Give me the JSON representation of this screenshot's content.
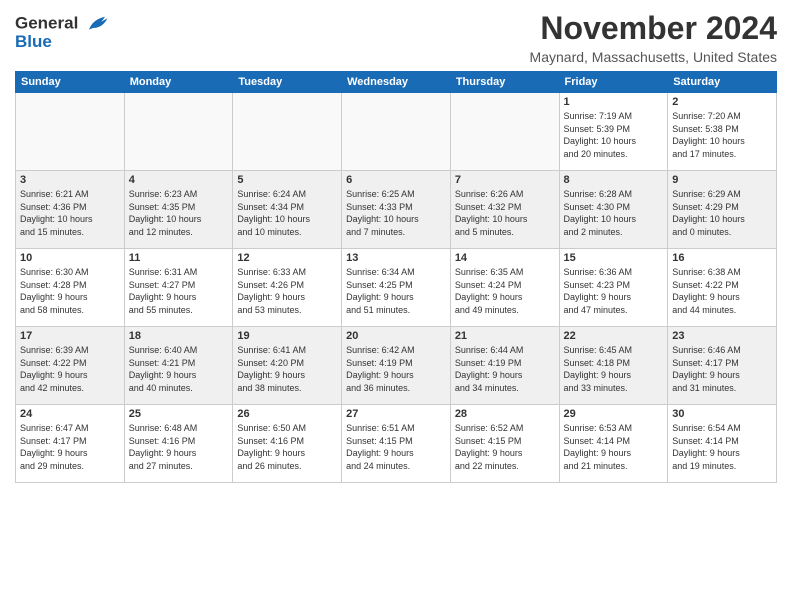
{
  "logo": {
    "line1": "General",
    "line2": "Blue"
  },
  "title": "November 2024",
  "location": "Maynard, Massachusetts, United States",
  "headers": [
    "Sunday",
    "Monday",
    "Tuesday",
    "Wednesday",
    "Thursday",
    "Friday",
    "Saturday"
  ],
  "rows": [
    [
      {
        "day": "",
        "info": ""
      },
      {
        "day": "",
        "info": ""
      },
      {
        "day": "",
        "info": ""
      },
      {
        "day": "",
        "info": ""
      },
      {
        "day": "",
        "info": ""
      },
      {
        "day": "1",
        "info": "Sunrise: 7:19 AM\nSunset: 5:39 PM\nDaylight: 10 hours\nand 20 minutes."
      },
      {
        "day": "2",
        "info": "Sunrise: 7:20 AM\nSunset: 5:38 PM\nDaylight: 10 hours\nand 17 minutes."
      }
    ],
    [
      {
        "day": "3",
        "info": "Sunrise: 6:21 AM\nSunset: 4:36 PM\nDaylight: 10 hours\nand 15 minutes."
      },
      {
        "day": "4",
        "info": "Sunrise: 6:23 AM\nSunset: 4:35 PM\nDaylight: 10 hours\nand 12 minutes."
      },
      {
        "day": "5",
        "info": "Sunrise: 6:24 AM\nSunset: 4:34 PM\nDaylight: 10 hours\nand 10 minutes."
      },
      {
        "day": "6",
        "info": "Sunrise: 6:25 AM\nSunset: 4:33 PM\nDaylight: 10 hours\nand 7 minutes."
      },
      {
        "day": "7",
        "info": "Sunrise: 6:26 AM\nSunset: 4:32 PM\nDaylight: 10 hours\nand 5 minutes."
      },
      {
        "day": "8",
        "info": "Sunrise: 6:28 AM\nSunset: 4:30 PM\nDaylight: 10 hours\nand 2 minutes."
      },
      {
        "day": "9",
        "info": "Sunrise: 6:29 AM\nSunset: 4:29 PM\nDaylight: 10 hours\nand 0 minutes."
      }
    ],
    [
      {
        "day": "10",
        "info": "Sunrise: 6:30 AM\nSunset: 4:28 PM\nDaylight: 9 hours\nand 58 minutes."
      },
      {
        "day": "11",
        "info": "Sunrise: 6:31 AM\nSunset: 4:27 PM\nDaylight: 9 hours\nand 55 minutes."
      },
      {
        "day": "12",
        "info": "Sunrise: 6:33 AM\nSunset: 4:26 PM\nDaylight: 9 hours\nand 53 minutes."
      },
      {
        "day": "13",
        "info": "Sunrise: 6:34 AM\nSunset: 4:25 PM\nDaylight: 9 hours\nand 51 minutes."
      },
      {
        "day": "14",
        "info": "Sunrise: 6:35 AM\nSunset: 4:24 PM\nDaylight: 9 hours\nand 49 minutes."
      },
      {
        "day": "15",
        "info": "Sunrise: 6:36 AM\nSunset: 4:23 PM\nDaylight: 9 hours\nand 47 minutes."
      },
      {
        "day": "16",
        "info": "Sunrise: 6:38 AM\nSunset: 4:22 PM\nDaylight: 9 hours\nand 44 minutes."
      }
    ],
    [
      {
        "day": "17",
        "info": "Sunrise: 6:39 AM\nSunset: 4:22 PM\nDaylight: 9 hours\nand 42 minutes."
      },
      {
        "day": "18",
        "info": "Sunrise: 6:40 AM\nSunset: 4:21 PM\nDaylight: 9 hours\nand 40 minutes."
      },
      {
        "day": "19",
        "info": "Sunrise: 6:41 AM\nSunset: 4:20 PM\nDaylight: 9 hours\nand 38 minutes."
      },
      {
        "day": "20",
        "info": "Sunrise: 6:42 AM\nSunset: 4:19 PM\nDaylight: 9 hours\nand 36 minutes."
      },
      {
        "day": "21",
        "info": "Sunrise: 6:44 AM\nSunset: 4:19 PM\nDaylight: 9 hours\nand 34 minutes."
      },
      {
        "day": "22",
        "info": "Sunrise: 6:45 AM\nSunset: 4:18 PM\nDaylight: 9 hours\nand 33 minutes."
      },
      {
        "day": "23",
        "info": "Sunrise: 6:46 AM\nSunset: 4:17 PM\nDaylight: 9 hours\nand 31 minutes."
      }
    ],
    [
      {
        "day": "24",
        "info": "Sunrise: 6:47 AM\nSunset: 4:17 PM\nDaylight: 9 hours\nand 29 minutes."
      },
      {
        "day": "25",
        "info": "Sunrise: 6:48 AM\nSunset: 4:16 PM\nDaylight: 9 hours\nand 27 minutes."
      },
      {
        "day": "26",
        "info": "Sunrise: 6:50 AM\nSunset: 4:16 PM\nDaylight: 9 hours\nand 26 minutes."
      },
      {
        "day": "27",
        "info": "Sunrise: 6:51 AM\nSunset: 4:15 PM\nDaylight: 9 hours\nand 24 minutes."
      },
      {
        "day": "28",
        "info": "Sunrise: 6:52 AM\nSunset: 4:15 PM\nDaylight: 9 hours\nand 22 minutes."
      },
      {
        "day": "29",
        "info": "Sunrise: 6:53 AM\nSunset: 4:14 PM\nDaylight: 9 hours\nand 21 minutes."
      },
      {
        "day": "30",
        "info": "Sunrise: 6:54 AM\nSunset: 4:14 PM\nDaylight: 9 hours\nand 19 minutes."
      }
    ]
  ]
}
